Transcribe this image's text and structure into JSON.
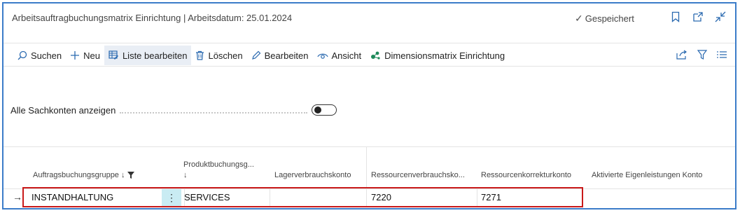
{
  "window": {
    "title": "Arbeitsauftragbuchungsmatrix Einrichtung | Arbeitsdatum: 25.01.2024",
    "saved_label": "Gespeichert"
  },
  "actions": [
    {
      "label": "Suchen",
      "icon": "search-icon"
    },
    {
      "label": "Neu",
      "icon": "plus-icon"
    },
    {
      "label": "Liste bearbeiten",
      "icon": "edit-list-icon",
      "active": true
    },
    {
      "label": "Löschen",
      "icon": "trash-icon"
    },
    {
      "label": "Bearbeiten",
      "icon": "pencil-icon"
    },
    {
      "label": "Ansicht",
      "icon": "eye-icon"
    },
    {
      "label": "Dimensionsmatrix Einrichtung",
      "icon": "dimensions-icon"
    }
  ],
  "toggle": {
    "label": "Alle Sachkonten anzeigen",
    "on": false
  },
  "table": {
    "columns": [
      "Auftragsbuchungsgruppe ↓",
      "Produktbuchungsg...",
      "Lagerverbrauchskonto",
      "Ressourcenverbrauchsko...",
      "Ressourcenkorrekturkonto",
      "Aktivierte Eigenleistungen Konto"
    ],
    "col2_sub": "↓",
    "rows": [
      [
        "INSTANDHALTUNG",
        "SERVICES",
        "",
        "7220",
        "7271",
        ""
      ]
    ]
  },
  "colors": {
    "accent": "#2b6ab0",
    "border": "#3b7cc9",
    "selection": "#c91a1a",
    "dots_button": "#c9ecf3"
  }
}
